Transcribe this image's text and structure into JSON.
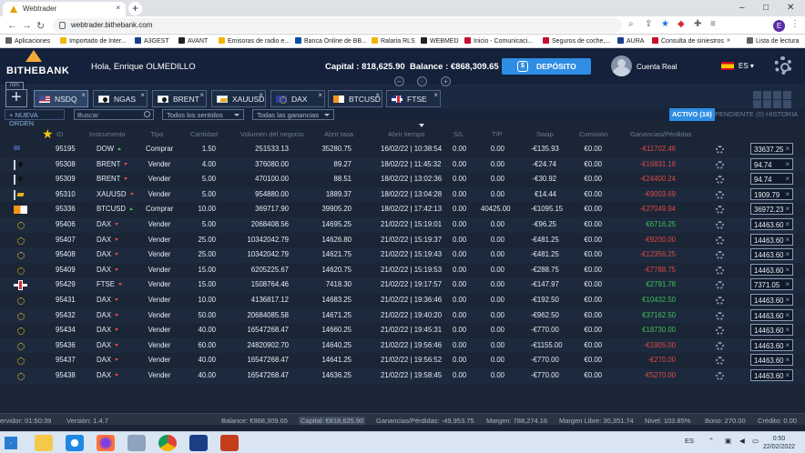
{
  "browser": {
    "tab_title": "Webtrader",
    "url": "webtrader.bithebank.com",
    "bookmarks": [
      "Aplicaciones",
      "Importado de Inter...",
      "A3GEST",
      "AVANT",
      "Emisoras de radio e...",
      "Banca Online de BB...",
      "Ralaria RLS",
      "WEBMED",
      "Inicio - Comunicaci...",
      "Seguros de coche,...",
      "AURA",
      "Consulta de siniestros"
    ],
    "reading_list": "Lista de lectura",
    "profile_initial": "E"
  },
  "header": {
    "logo": "BITHEBANK",
    "greeting": "Hola, Enrique OLMEDILLO",
    "capital": "Capital : 818,625.90",
    "balance": "Balance : €868,309.65",
    "deposit": "DEPÓSITO",
    "account": "Cuenta Real",
    "language": "ES"
  },
  "instrument_tabs": [
    {
      "label": "NSDQ",
      "flag": "us",
      "active": true
    },
    {
      "label": "NGAS",
      "flag": "oil",
      "active": false
    },
    {
      "label": "BRENT",
      "flag": "oil",
      "active": false
    },
    {
      "label": "XAUUSD",
      "flag": "gold",
      "active": false
    },
    {
      "label": "DAX",
      "flag": "eu",
      "active": false
    },
    {
      "label": "BTCUSD",
      "flag": "btc",
      "active": false
    },
    {
      "label": "FTSE",
      "flag": "uk",
      "active": false
    }
  ],
  "filters": {
    "new_order": "+ NUEVA ORDEN",
    "search_placeholder": "Buscar",
    "direction": "Todos los sentidos",
    "gains": "Todas las ganancias",
    "active": "ACTIVO (16)",
    "pending": "PENDIENTE (0)",
    "history": "HISTORIA"
  },
  "columns": [
    "ID",
    "Instrumento",
    "Tipo",
    "Cantidad",
    "Volumen del negocio",
    "Abrir tasa",
    "Abrir tiempo",
    "S/L",
    "T/P",
    "Swap",
    "Comisión",
    "Ganancias/Pérdidas"
  ],
  "rows": [
    {
      "flag": "us",
      "id": "95195",
      "instr": "DOW",
      "dir": "up",
      "tipo": "Comprar",
      "cant": "1.50",
      "vol": "251533.13",
      "tasa": "35280.75",
      "tiempo": "16/02/22 | 10:38:54",
      "sl": "0.00",
      "tp": "0.00",
      "swap": "-€135.93",
      "com": "€0.00",
      "pl": "-€11702.46",
      "plc": "neg",
      "price": "33637.25"
    },
    {
      "flag": "oil",
      "id": "95308",
      "instr": "BRENT",
      "dir": "dn",
      "tipo": "Vender",
      "cant": "4.00",
      "vol": "376080.00",
      "tasa": "89.27",
      "tiempo": "18/02/22 | 11:45:32",
      "sl": "0.00",
      "tp": "0.00",
      "swap": "-€24.74",
      "com": "€0.00",
      "pl": "-€16831.16",
      "plc": "neg",
      "price": "94.74"
    },
    {
      "flag": "oil",
      "id": "95309",
      "instr": "BRENT",
      "dir": "dn",
      "tipo": "Vender",
      "cant": "5.00",
      "vol": "470100.00",
      "tasa": "88.51",
      "tiempo": "18/02/22 | 13:02:36",
      "sl": "0.00",
      "tp": "0.00",
      "swap": "-€30.92",
      "com": "€0.00",
      "pl": "-€24400.24",
      "plc": "neg",
      "price": "94.74"
    },
    {
      "flag": "gold",
      "id": "95310",
      "instr": "XAUUSD",
      "dir": "dn",
      "tipo": "Vender",
      "cant": "5.00",
      "vol": "954880.00",
      "tasa": "1889.37",
      "tiempo": "18/02/22 | 13:04:28",
      "sl": "0.00",
      "tp": "0.00",
      "swap": "€14.44",
      "com": "€0.00",
      "pl": "-€9003.69",
      "plc": "neg",
      "price": "1909.79"
    },
    {
      "flag": "btc",
      "id": "95336",
      "instr": "BTCUSD",
      "dir": "up",
      "tipo": "Comprar",
      "cant": "10.00",
      "vol": "369717.90",
      "tasa": "39905.20",
      "tiempo": "18/02/22 | 17:42:13",
      "sl": "0.00",
      "tp": "40425.00",
      "swap": "-€1095.15",
      "com": "€0.00",
      "pl": "-€27049.94",
      "plc": "neg",
      "price": "36972.23"
    },
    {
      "flag": "eu",
      "id": "95406",
      "instr": "DAX",
      "dir": "dn",
      "tipo": "Vender",
      "cant": "5.00",
      "vol": "2068408.56",
      "tasa": "14695.25",
      "tiempo": "21/02/22 | 15:19:01",
      "sl": "0.00",
      "tp": "0.00",
      "swap": "-€96.25",
      "com": "€0.00",
      "pl": "€6716.25",
      "plc": "pos",
      "price": "14463.60"
    },
    {
      "flag": "eu",
      "id": "95407",
      "instr": "DAX",
      "dir": "dn",
      "tipo": "Vender",
      "cant": "25.00",
      "vol": "10342042.79",
      "tasa": "14626.80",
      "tiempo": "21/02/22 | 15:19:37",
      "sl": "0.00",
      "tp": "0.00",
      "swap": "-€481.25",
      "com": "€0.00",
      "pl": "-€9200.00",
      "plc": "neg",
      "price": "14463.60"
    },
    {
      "flag": "eu",
      "id": "95408",
      "instr": "DAX",
      "dir": "dn",
      "tipo": "Vender",
      "cant": "25.00",
      "vol": "10342042.79",
      "tasa": "14621.75",
      "tiempo": "21/02/22 | 15:19:43",
      "sl": "0.00",
      "tp": "0.00",
      "swap": "-€481.25",
      "com": "€0.00",
      "pl": "-€12356.25",
      "plc": "neg",
      "price": "14463.60"
    },
    {
      "flag": "eu",
      "id": "95409",
      "instr": "DAX",
      "dir": "dn",
      "tipo": "Vender",
      "cant": "15.00",
      "vol": "6205225.67",
      "tasa": "14620.75",
      "tiempo": "21/02/22 | 15:19:53",
      "sl": "0.00",
      "tp": "0.00",
      "swap": "-€288.75",
      "com": "€0.00",
      "pl": "-€7788.75",
      "plc": "neg",
      "price": "14463.60"
    },
    {
      "flag": "uk",
      "id": "95429",
      "instr": "FTSE",
      "dir": "dn",
      "tipo": "Vender",
      "cant": "15.00",
      "vol": "1508764.46",
      "tasa": "7418.30",
      "tiempo": "21/02/22 | 19:17:57",
      "sl": "0.00",
      "tp": "0.00",
      "swap": "-€147.97",
      "com": "€0.00",
      "pl": "€2791.78",
      "plc": "pos",
      "price": "7371.05"
    },
    {
      "flag": "eu",
      "id": "95431",
      "instr": "DAX",
      "dir": "dn",
      "tipo": "Vender",
      "cant": "10.00",
      "vol": "4136817.12",
      "tasa": "14683.25",
      "tiempo": "21/02/22 | 19:36:46",
      "sl": "0.00",
      "tp": "0.00",
      "swap": "-€192.50",
      "com": "€0.00",
      "pl": "€10432.50",
      "plc": "pos",
      "price": "14463.60"
    },
    {
      "flag": "eu",
      "id": "95432",
      "instr": "DAX",
      "dir": "dn",
      "tipo": "Vender",
      "cant": "50.00",
      "vol": "20684085.58",
      "tasa": "14671.25",
      "tiempo": "21/02/22 | 19:40:20",
      "sl": "0.00",
      "tp": "0.00",
      "swap": "-€962.50",
      "com": "€0.00",
      "pl": "€37162.50",
      "plc": "pos",
      "price": "14463.60"
    },
    {
      "flag": "eu",
      "id": "95434",
      "instr": "DAX",
      "dir": "dn",
      "tipo": "Vender",
      "cant": "40.00",
      "vol": "16547268.47",
      "tasa": "14660.25",
      "tiempo": "21/02/22 | 19:45:31",
      "sl": "0.00",
      "tp": "0.00",
      "swap": "-€770.00",
      "com": "€0.00",
      "pl": "€18730.00",
      "plc": "pos",
      "price": "14463.60"
    },
    {
      "flag": "eu",
      "id": "95436",
      "instr": "DAX",
      "dir": "dn",
      "tipo": "Vender",
      "cant": "60.00",
      "vol": "24820902.70",
      "tasa": "14640.25",
      "tiempo": "21/02/22 | 19:56:46",
      "sl": "0.00",
      "tp": "0.00",
      "swap": "-€1155.00",
      "com": "€0.00",
      "pl": "-€1905.00",
      "plc": "neg",
      "price": "14463.60"
    },
    {
      "flag": "eu",
      "id": "95437",
      "instr": "DAX",
      "dir": "dn",
      "tipo": "Vender",
      "cant": "40.00",
      "vol": "16547268.47",
      "tasa": "14641.25",
      "tiempo": "21/02/22 | 19:56:52",
      "sl": "0.00",
      "tp": "0.00",
      "swap": "-€770.00",
      "com": "€0.00",
      "pl": "-€270.00",
      "plc": "neg",
      "price": "14463.60"
    },
    {
      "flag": "eu",
      "id": "95438",
      "instr": "DAX",
      "dir": "dn",
      "tipo": "Vender",
      "cant": "40.00",
      "vol": "16547268.47",
      "tasa": "14636.25",
      "tiempo": "21/02/22 | 19:58:45",
      "sl": "0.00",
      "tp": "0.00",
      "swap": "-€770.00",
      "com": "€0.00",
      "pl": "-€5270.00",
      "plc": "neg",
      "price": "14463.60"
    }
  ],
  "status": {
    "server": "ervidor: 01:50:39",
    "version": "Versión: 1.4.7",
    "balance": "Balance: €868,309.65",
    "capital": "Capital: €818,625.90",
    "pl": "Ganancias/Pérdidas: -49,953.75",
    "margin": "Margen: 788,274.16",
    "free_margin": "Margen Libre: 30,351.74",
    "level": "Nivel: 103.85%",
    "bonus": "Bono: 270.00",
    "credit": "Crédito: 0.00"
  },
  "taskbar": {
    "lang": "ES",
    "time": "0:50",
    "date": "22/02/2022"
  }
}
